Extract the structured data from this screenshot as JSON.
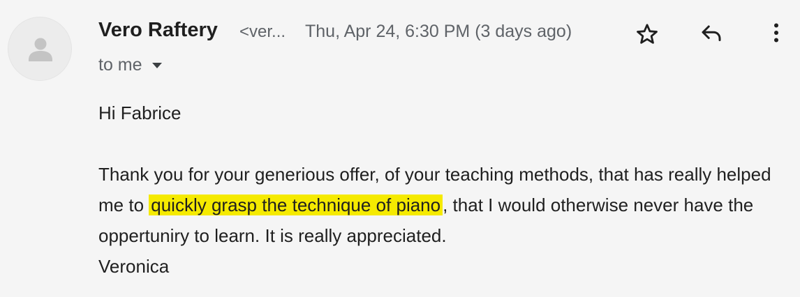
{
  "header": {
    "sender_name": "Vero Raftery",
    "sender_email_truncated": "<ver...",
    "date": "Thu, Apr 24, 6:30 PM (3 days ago)",
    "recipient": "to me"
  },
  "icons": {
    "avatar": "default-user-avatar",
    "star": "star-icon",
    "reply": "reply-icon",
    "more": "more-vert-icon",
    "recipient_caret": "caret-down-icon"
  },
  "message": {
    "greeting": "Hi Fabrice",
    "paragraph_before": "Thank you for your generious offer, of your teaching methods, that has really helped me to",
    "highlighted": "quickly grasp the technique of piano",
    "paragraph_after": ", that I would otherwise never have the oppertuniry to learn. It is really appreciated.",
    "signature": "Veronica"
  },
  "colors": {
    "background": "#f5f5f5",
    "highlight": "#f5ea00",
    "muted_text": "#5f6368",
    "text": "#1f1f1f"
  }
}
